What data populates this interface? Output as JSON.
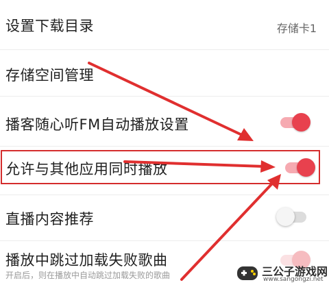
{
  "settings": {
    "download_dir": {
      "label": "设置下载目录",
      "value": "存储卡1"
    },
    "storage_manage": {
      "label": "存储空间管理"
    },
    "podcast_autoplay": {
      "label": "播客随心听FM自动播放设置",
      "toggle": "on"
    },
    "simultaneous_play": {
      "label": "允许与其他应用同时播放",
      "toggle": "on"
    },
    "live_recommend": {
      "label": "直播内容推荐",
      "toggle": "off"
    },
    "skip_failed": {
      "label": "播放中跳过加载失败歌曲",
      "description": "开启后，则在播放中自动跳过加载失败的歌曲"
    }
  },
  "colors": {
    "accent": "#e8414e",
    "annotation": "#d42c2c"
  },
  "watermark": {
    "title": "三公子游戏网",
    "url": "www.sangongzi.net"
  }
}
